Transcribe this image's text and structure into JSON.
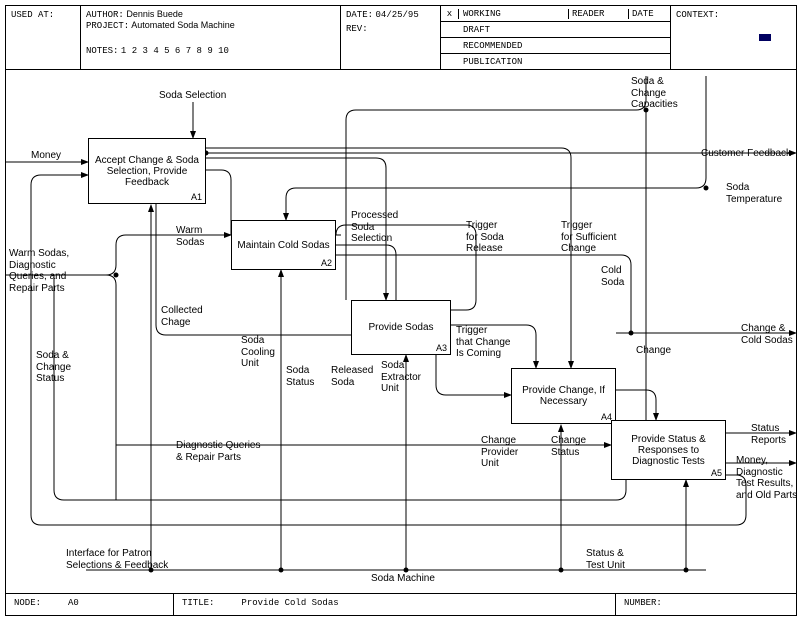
{
  "header": {
    "used_at": "USED AT:",
    "author_label": "AUTHOR:",
    "author": "Dennis Buede",
    "project_label": "PROJECT:",
    "project": "Automated Soda Machine",
    "notes_label": "NOTES:",
    "notes": "1  2  3  4  5  6  7  8  9  10",
    "date_label": "DATE:",
    "date": "04/25/95",
    "rev_label": "REV:",
    "status": {
      "working": "WORKING",
      "draft": "DRAFT",
      "recommended": "RECOMMENDED",
      "publication": "PUBLICATION",
      "reader": "READER",
      "date": "DATE",
      "x": "x"
    },
    "context_label": "CONTEXT:"
  },
  "footer": {
    "node_label": "NODE:",
    "node": "A0",
    "title_label": "TITLE:",
    "title": "Provide Cold Sodas",
    "number_label": "NUMBER:"
  },
  "boxes": {
    "a1": {
      "label": "Accept Change & Soda Selection, Provide Feedback",
      "id": "A1"
    },
    "a2": {
      "label": "Maintain Cold Sodas",
      "id": "A2"
    },
    "a3": {
      "label": "Provide Sodas",
      "id": "A3"
    },
    "a4": {
      "label": "Provide Change, If Necessary",
      "id": "A4"
    },
    "a5": {
      "label": "Provide Status & Responses to Diagnostic Tests",
      "id": "A5"
    }
  },
  "labels": {
    "soda_selection": "Soda Selection",
    "money": "Money",
    "warm_sodas_in": "Warm Sodas,\nDiagnostic\nQueries, and\nRepair Parts",
    "soda_change_status": "Soda &\nChange\nStatus",
    "warm_sodas": "Warm\nSodas",
    "collected_chage": "Collected\nChage",
    "soda_cooling_unit": "Soda\nCooling\nUnit",
    "soda_status": "Soda\nStatus",
    "processed_soda_selection": "Processed\nSoda\nSelection",
    "released_soda": "Released\nSoda",
    "soda_extractor_unit": "Soda\nExtractor\nUnit",
    "trigger_soda_release": "Trigger\nfor Soda\nRelease",
    "trigger_change_coming": "Trigger\nthat Change\nIs Coming",
    "trigger_sufficient_change": "Trigger\nfor Sufficient\nChange",
    "cold_soda": "Cold\nSoda",
    "change": "Change",
    "change_provider_unit": "Change\nProvider\nUnit",
    "change_status": "Change\nStatus",
    "diagnostic_queries": "Diagnostic Queries\n& Repair Parts",
    "interface_patron": "Interface for Patron\nSelections & Feedback",
    "soda_machine": "Soda Machine",
    "status_test_unit": "Status &\nTest Unit",
    "soda_change_capacities": "Soda &\nChange\nCapacities",
    "customer_feedback": "Customer Feedback",
    "soda_temperature": "Soda\nTemperature",
    "change_cold_sodas": "Change &\nCold Sodas",
    "status_reports": "Status\nReports",
    "money_diag_results": "Money,\nDiagnostic\nTest Results,\nand Old Parts"
  }
}
